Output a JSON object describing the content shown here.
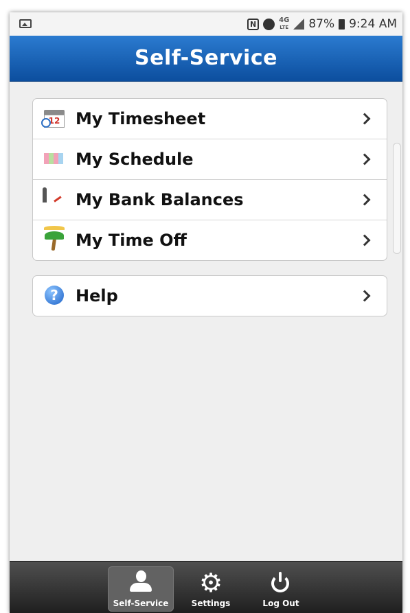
{
  "status_bar": {
    "battery": "87%",
    "time": "9:24 AM",
    "network": "4G",
    "network_sub": "LTE",
    "nfc": "N"
  },
  "header": {
    "title": "Self-Service"
  },
  "menu": {
    "items": [
      {
        "label": "My Timesheet",
        "icon": "calendar-clock-icon",
        "calendar_day": "12"
      },
      {
        "label": "My Schedule",
        "icon": "schedule-grid-icon"
      },
      {
        "label": "My Bank Balances",
        "icon": "gauge-icon"
      },
      {
        "label": "My Time Off",
        "icon": "palm-tree-icon"
      }
    ]
  },
  "help": {
    "label": "Help",
    "icon": "help-icon",
    "glyph": "?"
  },
  "tabbar": {
    "tabs": [
      {
        "label": "Self-Service",
        "icon": "user-icon",
        "active": true
      },
      {
        "label": "Settings",
        "icon": "gear-icon",
        "glyph": "⚙"
      },
      {
        "label": "Log Out",
        "icon": "power-icon"
      }
    ]
  },
  "colors": {
    "header_top": "#2b7bd0",
    "header_bottom": "#0c4e9e",
    "background": "#efefef"
  }
}
